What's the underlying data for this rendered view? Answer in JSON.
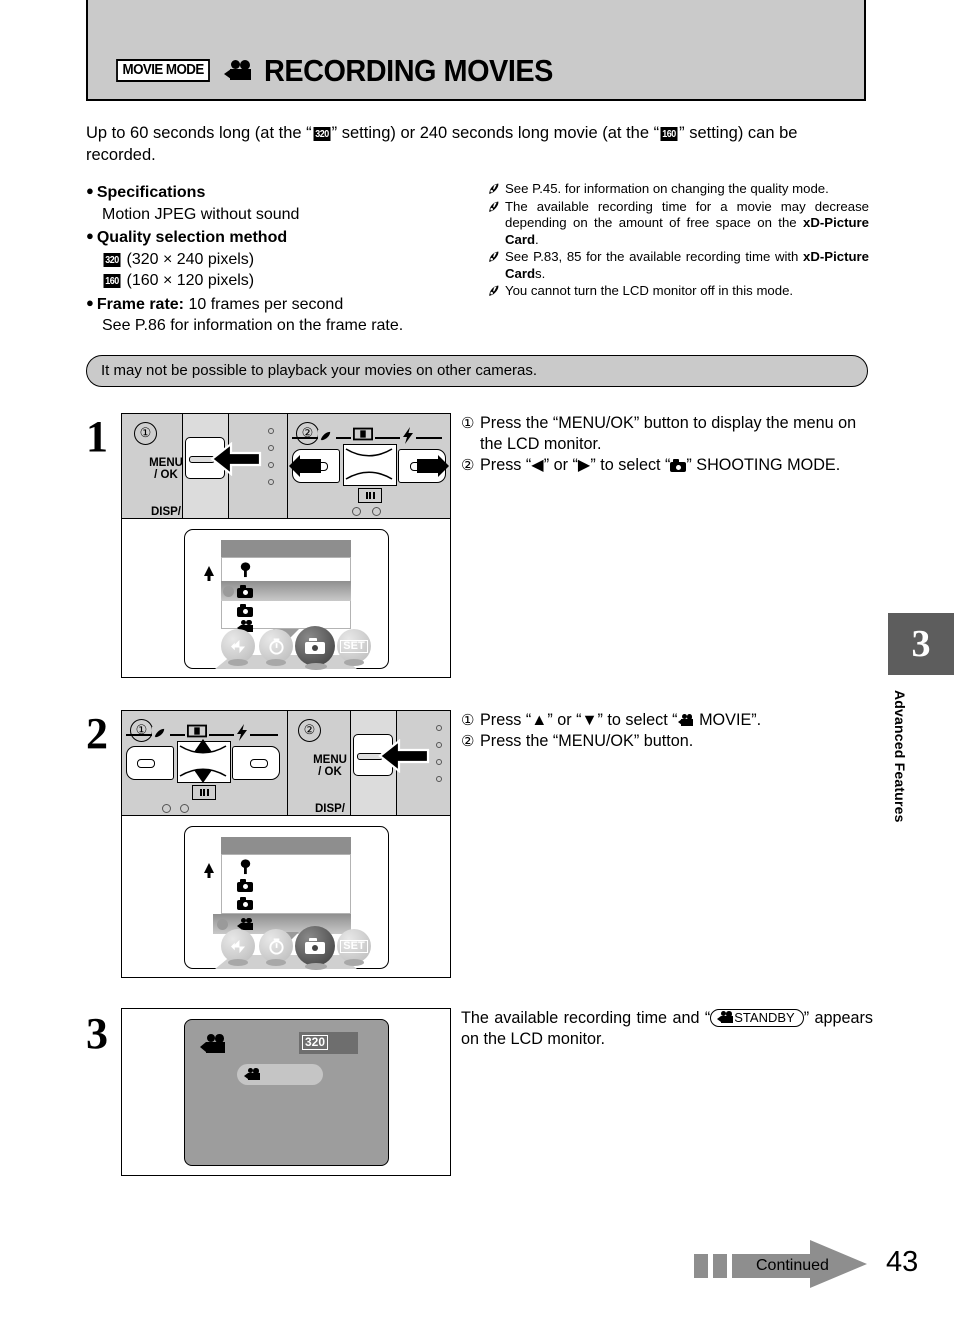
{
  "header": {
    "mode_badge": "MOVIE MODE",
    "title": "RECORDING MOVIES",
    "movie_icon": "movie-camera-icon"
  },
  "intro": {
    "part1": "Up to 60 seconds long (at the “",
    "q320": "320",
    "part2": "” setting) or 240 seconds long movie (at the “",
    "q160": "160",
    "part3": "” setting) can be recorded."
  },
  "specs": {
    "spec_heading": "Specifications",
    "spec_value": "Motion JPEG    without sound",
    "quality_heading": "Quality selection method",
    "quality_1_badge": "320",
    "quality_1_text": "(320 × 240 pixels)",
    "quality_2_badge": "160",
    "quality_2_text": "(160 × 120 pixels)",
    "frame_rate_label": "Frame rate:",
    "frame_rate_value": "10 frames per second",
    "frame_rate_note": "See P.86 for information on the frame rate."
  },
  "notes": [
    "See P.45. for information on changing the quality mode.",
    "The available recording time for a movie may decrease depending on the amount of free space on the xD-Picture Card.",
    "See P.83, 85 for the available recording time with xD-Picture Cards.",
    "You cannot turn the LCD monitor off in this mode."
  ],
  "caution": "It may not be possible to playback your movies on other cameras.",
  "steps": [
    {
      "number": "1",
      "callout_1": "①",
      "callout_2": "②",
      "line1": "Press the “MENU/OK” button to display the menu on the LCD monitor.",
      "line2_pre": "Press “",
      "line2_mid": "” or “",
      "line2_post": "” to select “",
      "line2_end": "” SHOOTING MODE.",
      "button_label_top": "MENU",
      "button_label_bottom": "/ OK",
      "button_label_disp": "DISP/"
    },
    {
      "number": "2",
      "callout_1": "①",
      "callout_2": "②",
      "line1_pre": "Press “",
      "line1_mid": "” or “",
      "line1_post": "” to select “",
      "line1_end": "MOVIE”.",
      "line2": "Press the “MENU/OK” button.",
      "button_label_top": "MENU",
      "button_label_bottom": "/ OK",
      "button_label_disp": "DISP/"
    },
    {
      "number": "3",
      "text_pre": "The available recording time and “",
      "standby": "STANDBY",
      "text_post": "” appears on the LCD monitor.",
      "quality_indicator": "320"
    }
  ],
  "lcd_menu": {
    "items": [
      "scene-icon",
      "shooting-mode-icon",
      "camera-icon",
      "movie-icon"
    ],
    "step1_selected_index": 1,
    "step2_selected_index": 3,
    "bottom_icons": [
      "flash-icon",
      "self-timer-icon",
      "camera-icon",
      "set-icon"
    ],
    "set_label": "SET"
  },
  "sidebar": {
    "chapter_number": "3",
    "chapter_label": "Advanced Features"
  },
  "footer": {
    "continued": "Continued",
    "page_number": "43"
  }
}
